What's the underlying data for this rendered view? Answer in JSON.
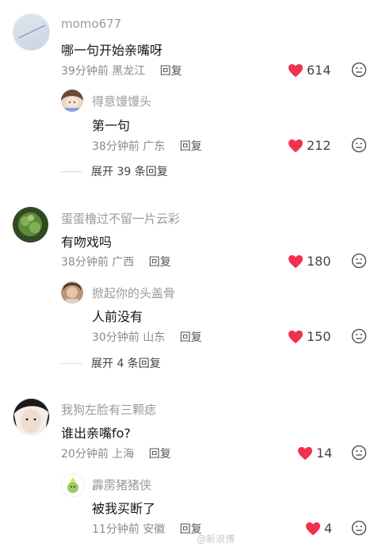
{
  "comments": [
    {
      "user": "momo677",
      "text": "哪一句开始亲嘴呀",
      "time": "39分钟前",
      "location": "黑龙江",
      "reply": "回复",
      "likes": "614",
      "replies": [
        {
          "user": "得意馒馒头",
          "text": "第一句",
          "time": "38分钟前",
          "location": "广东",
          "reply": "回复",
          "likes": "212"
        }
      ],
      "expand": "展开 39 条回复"
    },
    {
      "user": "蛋蛋橹过不留一片云彩",
      "text": "有吻戏吗",
      "time": "38分钟前",
      "location": "广西",
      "reply": "回复",
      "likes": "180",
      "replies": [
        {
          "user": "掀起你的头盖骨",
          "text": "人前没有",
          "time": "30分钟前",
          "location": "山东",
          "reply": "回复",
          "likes": "150"
        }
      ],
      "expand": "展开 4 条回复"
    },
    {
      "user": "我狗左脸有三颗痣",
      "text": "谁出亲嘴fo?",
      "time": "20分钟前",
      "location": "上海",
      "reply": "回复",
      "likes": "14",
      "replies": [
        {
          "user": "霹雳猪猪侠",
          "text": "被我买断了",
          "time": "11分钟前",
          "location": "安徽",
          "reply": "回复",
          "likes": "4"
        }
      ]
    }
  ],
  "watermark": "@新浪博",
  "colors": {
    "heart": "#f0314f",
    "username": "#9a9a9a",
    "text": "#161616",
    "meta": "#8a8a8a"
  },
  "icons": {
    "like": "heart-icon",
    "dislike": "dislike-face-icon"
  }
}
